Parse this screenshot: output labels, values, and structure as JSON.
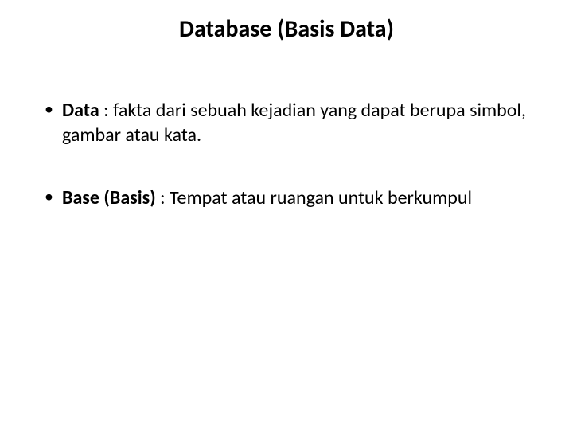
{
  "title": "Database (Basis Data)",
  "bullets": [
    {
      "term": "Data",
      "definition": " : fakta dari sebuah kejadian yang dapat berupa simbol, gambar atau kata."
    },
    {
      "term": "Base (Basis)",
      "definition": " : Tempat atau ruangan untuk berkumpul"
    }
  ]
}
